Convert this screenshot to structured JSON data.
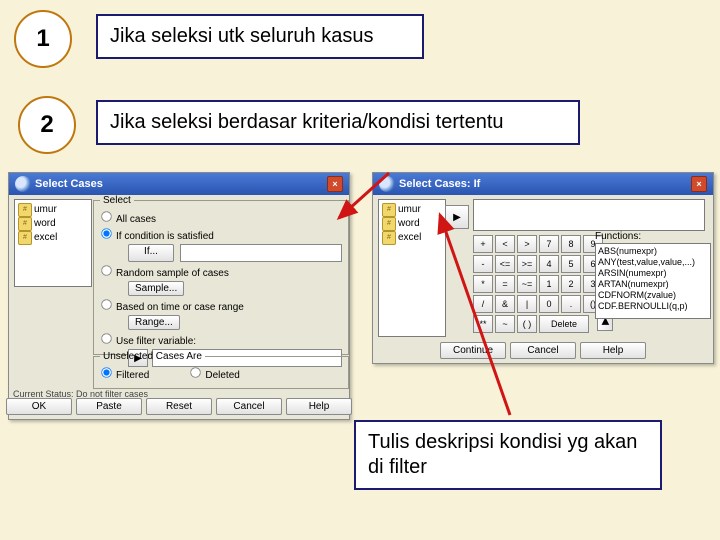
{
  "bullets": {
    "b1": "1",
    "b2": "2"
  },
  "captions": {
    "t1": "Jika seleksi utk seluruh kasus",
    "t2": "Jika seleksi berdasar kriteria/kondisi tertentu",
    "t3": "Tulis deskripsi kondisi yg akan di filter"
  },
  "vars": {
    "v1": "umur",
    "v2": "word",
    "v3": "excel"
  },
  "win1": {
    "title": "Select Cases",
    "grp_select": "Select",
    "r_all": "All cases",
    "r_if": "If condition is satisfied",
    "btn_if": "If...",
    "r_rand": "Random sample of cases",
    "btn_sample": "Sample...",
    "r_range": "Based on time or case range",
    "btn_range": "Range...",
    "r_filter": "Use filter variable:",
    "grp_unsel": "Unselected Cases Are",
    "r_filtered": "Filtered",
    "r_deleted": "Deleted",
    "status": "Current Status: Do not filter cases",
    "ok": "OK",
    "paste": "Paste",
    "reset": "Reset",
    "cancel": "Cancel",
    "help": "Help"
  },
  "win2": {
    "title": "Select Cases: If",
    "funcs_lbl": "Functions:",
    "funcs": [
      "ABS(numexpr)",
      "ANY(test,value,value,...)",
      "ARSIN(numexpr)",
      "ARTAN(numexpr)",
      "CDFNORM(zvalue)",
      "CDF.BERNOULLI(q,p)"
    ],
    "keys_op": [
      [
        "+",
        "<",
        ">",
        "7",
        "8",
        "9"
      ],
      [
        "-",
        "<=",
        ">=",
        "4",
        "5",
        "6"
      ],
      [
        "*",
        "=",
        "~=",
        "1",
        "2",
        "3"
      ],
      [
        "/",
        "&",
        "|",
        "0",
        ".",
        "()"
      ],
      [
        "**",
        "~",
        "( )",
        "Delete"
      ]
    ],
    "continue": "Continue",
    "cancel": "Cancel",
    "help": "Help"
  }
}
